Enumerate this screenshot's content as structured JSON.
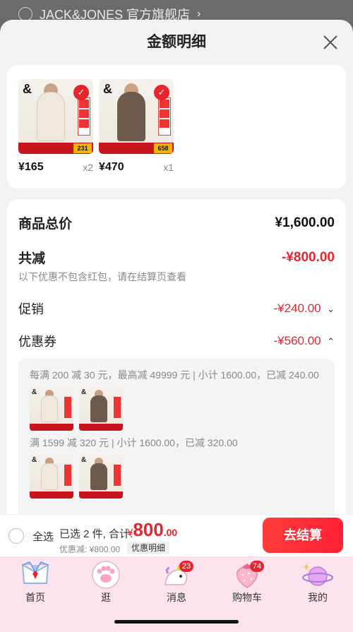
{
  "background": {
    "store_name": "JACK&JONES 官方旗舰店",
    "chevron": "›"
  },
  "sheet": {
    "title": "金额明细"
  },
  "products": [
    {
      "price": "¥165",
      "qty": "x2",
      "chip": "231",
      "check": "✓"
    },
    {
      "price": "¥470",
      "qty": "x1",
      "chip": "658",
      "check": "✓"
    }
  ],
  "detail": {
    "total_label": "商品总价",
    "total_value": "¥1,600.00",
    "reduce_label": "共减",
    "reduce_value": "-¥800.00",
    "reduce_note": "以下优惠不包含红包，请在结算页查看",
    "promo_label": "促销",
    "promo_value": "-¥240.00",
    "promo_arrow": "⌄",
    "coupon_label": "优惠券",
    "coupon_value": "-¥560.00",
    "coupon_arrow": "⌃",
    "coupon_rule_1": "每满 200 减 30 元，最高减 49999 元 | 小计 1600.00，已减 240.00",
    "coupon_rule_2": "满 1599 减 320 元 | 小计 1600.00，已减 320.00"
  },
  "bottom_bar": {
    "select_all": "全选",
    "selected": "已选 2 件, 合计:",
    "currency": "¥",
    "amount_int": "800",
    "amount_dec": ".00",
    "discount": "优惠减: ¥800.00",
    "detail_btn": "优惠明细",
    "checkout": "去结算"
  },
  "tabs": [
    {
      "label": "首页",
      "icon": "sailor-collar-icon"
    },
    {
      "label": "逛",
      "icon": "paw-icon"
    },
    {
      "label": "消息",
      "icon": "unicorn-icon",
      "badge": "23"
    },
    {
      "label": "购物车",
      "icon": "strawberry-icon",
      "badge": "74"
    },
    {
      "label": "我的",
      "icon": "planet-icon"
    }
  ],
  "colors": {
    "accent": "#e8242e",
    "tabbar_bg": "#fde3ee",
    "sheet_bg": "#f2f2f2"
  }
}
